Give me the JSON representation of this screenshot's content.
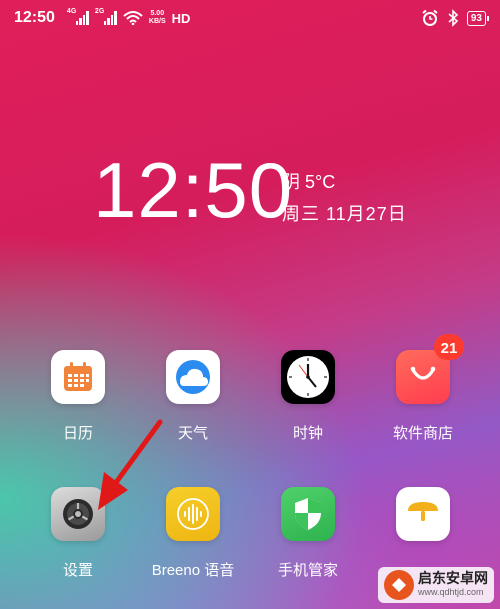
{
  "status_bar": {
    "time": "12:50",
    "signal1_tag": "4G",
    "signal2_tag": "2G",
    "net_speed_value": "5.00",
    "net_speed_unit": "KB/S",
    "hd_label": "HD",
    "battery_level": "93"
  },
  "clock_widget": {
    "time": "12:50",
    "weather": "阴 5°C",
    "date": "周三  11月27日"
  },
  "apps": [
    {
      "label": "日历",
      "icon": "calendar-icon"
    },
    {
      "label": "天气",
      "icon": "weather-cloud-icon"
    },
    {
      "label": "时钟",
      "icon": "clock-icon"
    },
    {
      "label": "软件商店",
      "icon": "store-bag-icon",
      "badge": "21"
    },
    {
      "label": "设置",
      "icon": "settings-gear-icon"
    },
    {
      "label": "Breeno 语音",
      "icon": "voice-wave-icon"
    },
    {
      "label": "手机管家",
      "icon": "shield-icon"
    },
    {
      "label": "",
      "icon": "notes-icon"
    }
  ],
  "watermark": {
    "title": "启东安卓网",
    "url": "www.qdhtjd.com"
  },
  "colors": {
    "badge_red": "#ff3b30",
    "store_red": "#ff4a4a",
    "weather_blue": "#2a8cf0",
    "voice_yellow": "#f2c21c",
    "shield_green": "#3cc35a",
    "arrow_red": "#e01818"
  }
}
